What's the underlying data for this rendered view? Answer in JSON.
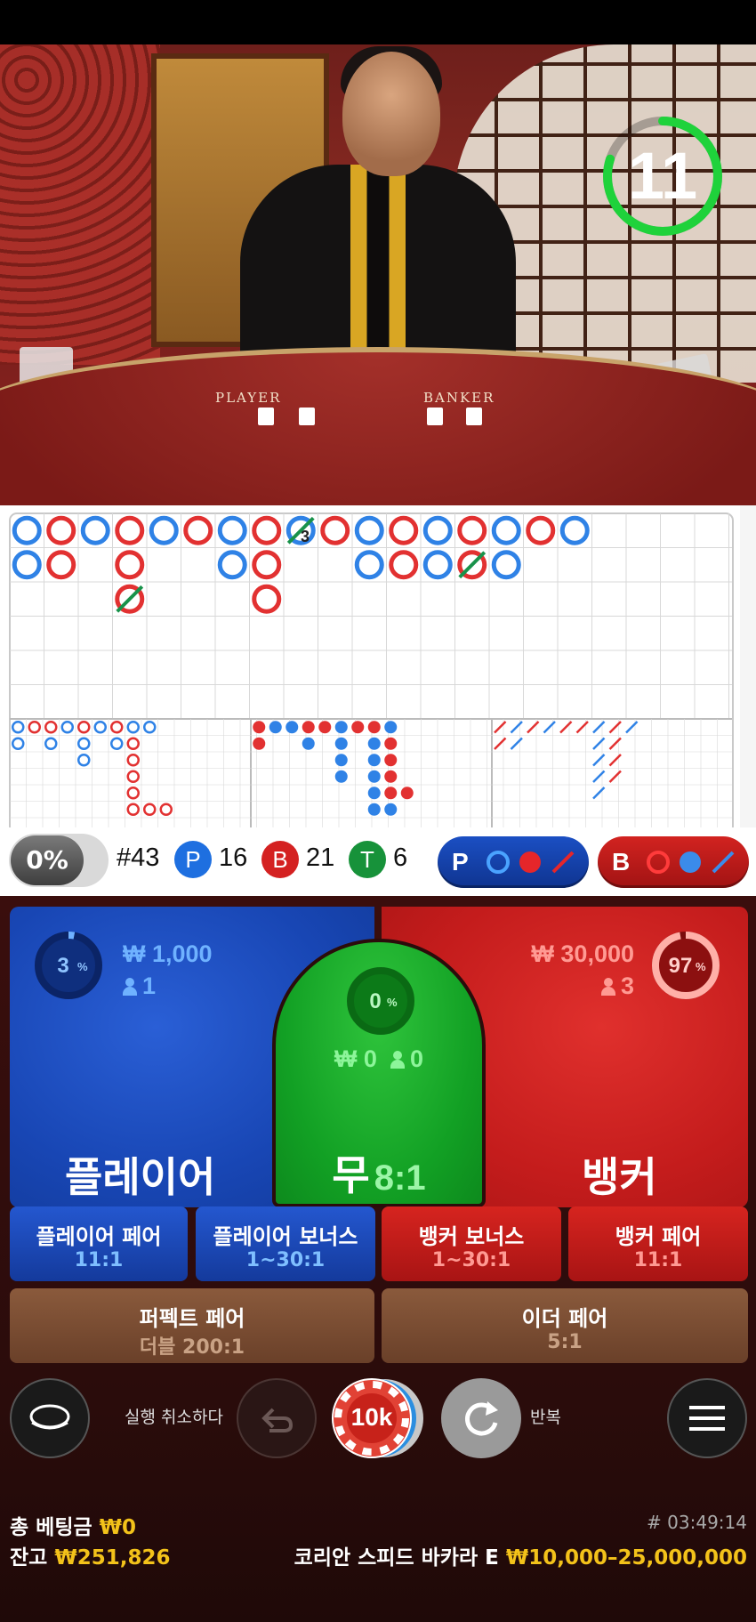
{
  "video": {
    "timer": "11",
    "timer_fraction": 0.8,
    "table_labels": {
      "player": "PLAYER",
      "banker": "BANKER"
    }
  },
  "roadmap": {
    "big_road_marker": "3",
    "counts": {
      "round": "#43",
      "player_label": "P",
      "player": "16",
      "banker_label": "B",
      "banker": "21",
      "tie_label": "T",
      "tie": "6"
    },
    "toggle_percent": "0%",
    "predict_player_label": "P",
    "predict_banker_label": "B"
  },
  "bets": {
    "player": {
      "name": "플레이어",
      "percent": "3",
      "percent_sign": "%",
      "percent_value": 3,
      "amount": "₩ 1,000",
      "players": "1"
    },
    "tie": {
      "name": "무",
      "odds": "8:1",
      "percent": "0",
      "percent_sign": "%",
      "percent_value": 0,
      "amount": "₩ 0",
      "players": "0"
    },
    "banker": {
      "name": "뱅커",
      "percent": "97",
      "percent_sign": "%",
      "percent_value": 97,
      "amount": "₩ 30,000",
      "players": "3"
    },
    "side": [
      {
        "name": "플레이어 페어",
        "odds": "11:1"
      },
      {
        "name": "플레이어 보너스",
        "odds": "1~30:1"
      },
      {
        "name": "뱅커 보너스",
        "odds": "1~30:1"
      },
      {
        "name": "뱅커 페어",
        "odds": "11:1"
      }
    ],
    "perfect_pair": {
      "name": "퍼펙트 페어",
      "odds": "더블 200:1"
    },
    "either_pair": {
      "name": "이더 페어",
      "odds": "5:1"
    }
  },
  "controls": {
    "undo_label": "실행 취소하다",
    "chip_value": "10k",
    "repeat_label": "반복"
  },
  "footer": {
    "total_bet_label": "총 베팅금",
    "total_bet": "₩0",
    "balance_label": "잔고",
    "balance": "₩251,826",
    "game_id": "# 03:49:14",
    "table_name": "코리안 스피드 바카라 E",
    "limits": "₩10,000–25,000,000"
  },
  "colors": {
    "player_blue": "#1e5bd8",
    "banker_red": "#d42121",
    "tie_green": "#12a024",
    "gold": "#f3c21a"
  }
}
